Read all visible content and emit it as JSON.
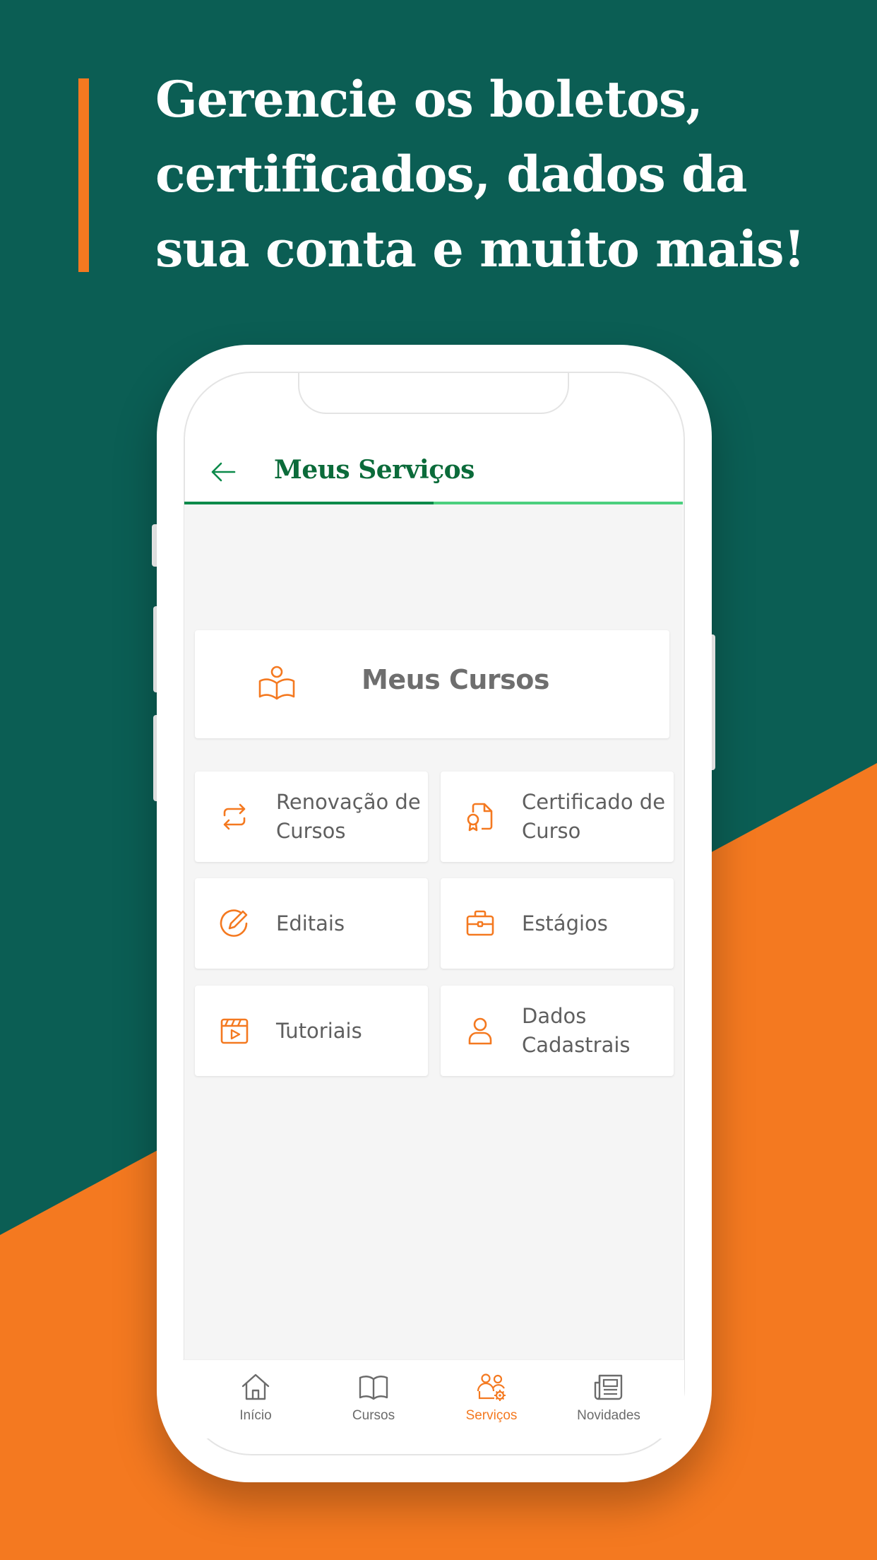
{
  "promo": {
    "headline_lines": [
      "Gerencie os boletos,",
      "certificados, dados da",
      "sua conta e muito mais!"
    ]
  },
  "colors": {
    "brand_green": "#0b5e54",
    "accent_orange": "#f47920",
    "title_green": "#0b6b3a",
    "progress_done": "#0b8a4a",
    "progress_track": "#4ccf7e"
  },
  "header": {
    "title": "Meus Serviços",
    "back_icon": "arrow-left-icon"
  },
  "progress": {
    "fraction": 0.5
  },
  "main_card": {
    "label": "Meus Cursos",
    "icon": "book-reader-icon"
  },
  "services": [
    {
      "label": "Renovação de Cursos",
      "icon": "repeat-arrows-icon"
    },
    {
      "label": "Certificado de Curso",
      "icon": "certificate-document-icon"
    },
    {
      "label": "Editais",
      "icon": "pencil-circle-icon"
    },
    {
      "label": "Estágios",
      "icon": "briefcase-icon"
    },
    {
      "label": "Tutoriais",
      "icon": "video-clapper-icon"
    },
    {
      "label": "Dados Cadastrais",
      "icon": "user-icon"
    }
  ],
  "tabbar": {
    "active": "Serviços",
    "items": [
      {
        "label": "Início",
        "icon": "home-icon"
      },
      {
        "label": "Cursos",
        "icon": "open-book-icon"
      },
      {
        "label": "Serviços",
        "icon": "users-gear-icon"
      },
      {
        "label": "Novidades",
        "icon": "newspaper-icon"
      }
    ]
  }
}
